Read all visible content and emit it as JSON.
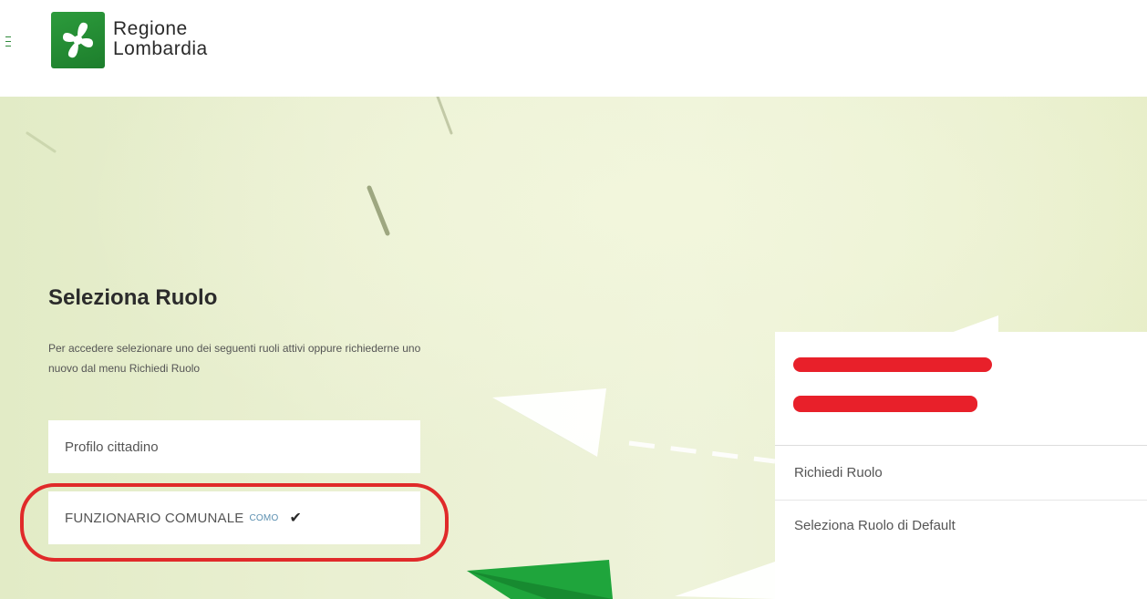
{
  "header": {
    "menu_icon": "hamburger-icon",
    "logo_icon": "rosa-camuna-icon",
    "logo_line1": "Regione",
    "logo_line2": "Lombardia",
    "brand_color": "#2c9b3c"
  },
  "main": {
    "title": "Seleziona Ruolo",
    "description": "Per accedere selezionare uno dei seguenti ruoli attivi oppure richiederne uno nuovo dal menu Richiedi Ruolo",
    "roles": [
      {
        "label": "Profilo cittadino",
        "sub": "",
        "selected": false
      },
      {
        "label": "FUNZIONARIO COMUNALE",
        "sub": "COMO",
        "selected": true,
        "check_icon": "check-icon"
      }
    ],
    "highlight_color": "#e02a2a"
  },
  "user_menu": {
    "redaction_color": "#e8202a",
    "items": [
      {
        "label": "Richiedi Ruolo"
      },
      {
        "label": "Seleziona Ruolo di Default"
      }
    ]
  }
}
